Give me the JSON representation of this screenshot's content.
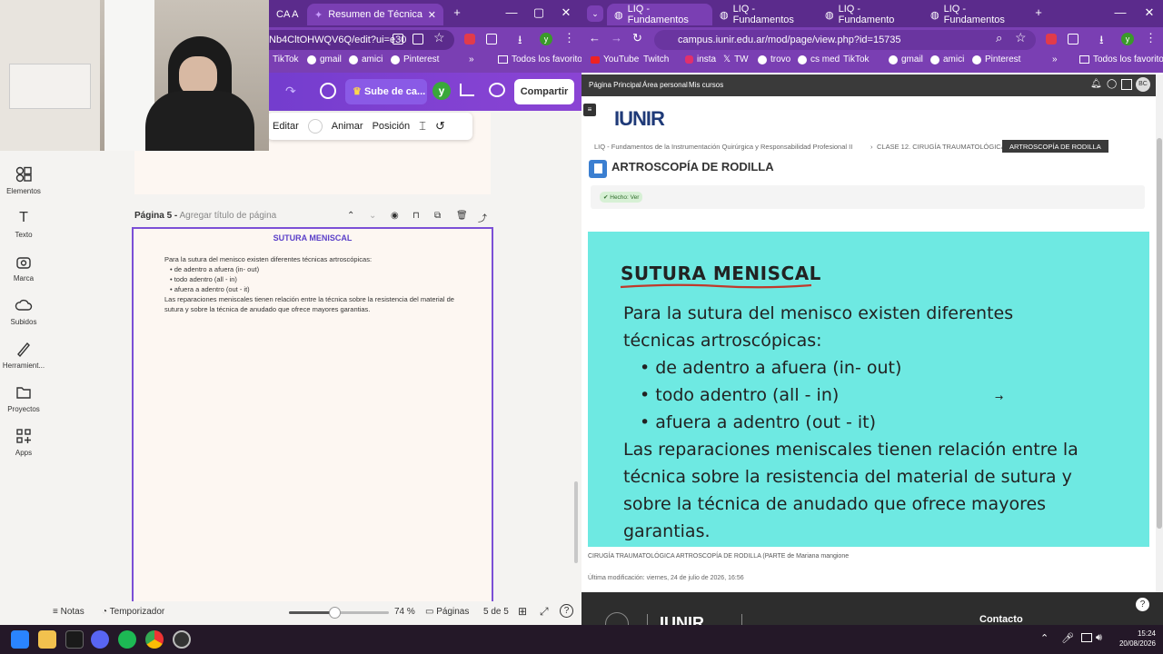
{
  "left_window": {
    "tabs": [
      {
        "label": "CA A"
      },
      {
        "label": "Resumen de Técnica Quirúrgic"
      }
    ],
    "url": "Nb4CltOHWQV6Q/edit?ui=e30",
    "bookmarks": [
      "TikTok",
      "gmail",
      "amici",
      "Pinterest"
    ],
    "bookmarks_more": "»",
    "all_bookmarks": "Todos los favoritos",
    "canva": {
      "upload_label": "Sube de ca...",
      "avatar_initial": "y",
      "share_label": "Compartir",
      "sidebar": [
        "Elementos",
        "Texto",
        "Marca",
        "Subidos",
        "Herramient...",
        "Proyectos",
        "Apps"
      ],
      "toolbar": {
        "edit": "Editar",
        "animate": "Animar",
        "position": "Posición"
      },
      "page_label": "Página 5 -",
      "page_title_placeholder": "Agregar título de página",
      "doc": {
        "heading": "SUTURA MENISCAL",
        "intro": "Para la sutura del menisco existen diferentes técnicas artroscópicas:",
        "bullets": [
          "de adentro a afuera (in- out)",
          "todo adentro (all - in)",
          "afuera a adentro (out - it)"
        ],
        "closing": "Las reparaciones meniscales tienen relación entre la técnica sobre la resistencia del material de sutura y sobre la técnica de anudado que ofrece mayores garantias."
      },
      "bottom": {
        "notes": "Notas",
        "timer": "Temporizador",
        "zoom": "74 %",
        "zoom_fraction": 0.45,
        "pages": "Páginas",
        "page_count": "5 de 5"
      }
    }
  },
  "right_window": {
    "tabs": [
      "LIQ - Fundamentos",
      "LIQ - Fundamentos",
      "LIQ - Fundamento",
      "LIQ - Fundamentos"
    ],
    "url": "campus.iunir.edu.ar/mod/page/view.php?id=15735",
    "bookmarks": [
      "YouTube",
      "Twitch",
      "insta",
      "TW",
      "trovo",
      "cs med",
      "TikTok",
      "gmail",
      "amici",
      "Pinterest"
    ],
    "all_bookmarks": "Todos los favoritos",
    "nav": [
      "Página Principal",
      "Área personal",
      "Mis cursos"
    ],
    "user_initials": "BC",
    "logo": "IUNIR",
    "breadcrumb": [
      "LIQ - Fundamentos de la Instrumentación Quirúrgica y Responsabilidad Profesional II",
      "CLASE 12. CIRUGÍA TRAUMATOLÓGICA",
      "ARTROSCOPÍA DE RODILLA"
    ],
    "page_title": "ARTROSCOPÍA DE RODILLA",
    "done_badge": "✔ Hecho: Ver",
    "slide": {
      "heading": "SUTURA MENISCAL",
      "line1": "Para la sutura del menisco existen diferentes",
      "line2": "técnicas artroscópicas:",
      "bullets": [
        "de adentro a afuera (in- out)",
        "todo adentro (all - in)",
        "afuera a adentro (out - it)"
      ],
      "para": [
        "Las reparaciones meniscales tienen relación entre la",
        "técnica sobre la resistencia del material de sutura y",
        "sobre la técnica de anudado que ofrece mayores",
        "garantias."
      ]
    },
    "caption_title": "CIRUGÍA TRAUMATOLÓGICA ARTROSCOPÍA DE RODILLA (PARTE",
    "caption_by": "de Mariana mangione",
    "last_modified": "Última modificación: viernes, 24 de julio de 2026, 16:56",
    "footer_contact": "Contacto",
    "footer_logo": "IUNIR"
  },
  "taskbar": {
    "time": "15:24",
    "date": "20/08/2026"
  },
  "colors": {
    "browser_purple": "#5b2b8c",
    "slide_bg": "#6ee9e2",
    "canva_accent": "#7b4fd6",
    "underline_red": "#c0392b"
  }
}
